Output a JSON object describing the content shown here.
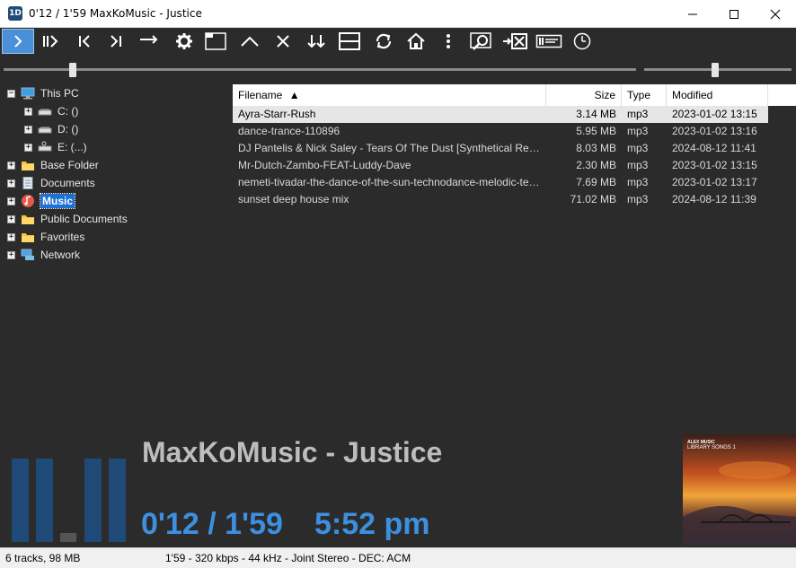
{
  "window": {
    "title": "0'12 / 1'59 MaxKoMusic - Justice",
    "app_icon_text": "1D"
  },
  "toolbar": {
    "buttons": [
      {
        "name": "play-icon"
      },
      {
        "name": "pause-play-icon"
      },
      {
        "name": "previous-track-icon"
      },
      {
        "name": "next-track-icon"
      },
      {
        "name": "arrow-right-icon"
      },
      {
        "name": "gear-icon"
      },
      {
        "name": "window-icon"
      },
      {
        "name": "chevron-up-icon"
      },
      {
        "name": "close-x-icon"
      },
      {
        "name": "sort-down-icon"
      },
      {
        "name": "split-view-icon"
      },
      {
        "name": "refresh-icon"
      },
      {
        "name": "home-icon"
      },
      {
        "name": "more-vertical-icon"
      },
      {
        "name": "search-icon"
      },
      {
        "name": "remove-icon"
      },
      {
        "name": "playlist-icon"
      },
      {
        "name": "clock-icon"
      }
    ]
  },
  "sliders": {
    "position_fraction": 0.11,
    "volume_fraction": 0.48
  },
  "tree": {
    "items": [
      {
        "label": "This PC",
        "icon": "monitor-icon",
        "expander": "−"
      },
      {
        "label": "C: ()",
        "icon": "drive-icon",
        "expander": "+"
      },
      {
        "label": "D: ()",
        "icon": "drive-icon",
        "expander": "+"
      },
      {
        "label": "E: (...)",
        "icon": "network-drive-icon",
        "expander": "+"
      },
      {
        "label": "Base Folder",
        "icon": "folder-icon",
        "expander": "+"
      },
      {
        "label": "Documents",
        "icon": "documents-icon",
        "expander": "+"
      },
      {
        "label": "Music",
        "icon": "music-icon",
        "expander": "+",
        "selected": true
      },
      {
        "label": "Public Documents",
        "icon": "folder-icon",
        "expander": "+"
      },
      {
        "label": "Favorites",
        "icon": "folder-icon",
        "expander": "+"
      },
      {
        "label": "Network",
        "icon": "network-icon",
        "expander": "+"
      }
    ]
  },
  "filelist": {
    "columns": {
      "filename": "Filename",
      "sort_arrow": "▲",
      "size": "Size",
      "type": "Type",
      "modified": "Modified"
    },
    "rows": [
      {
        "filename": "Ayra-Starr-Rush",
        "size": "3.14 MB",
        "type": "mp3",
        "modified": "2023-01-02 13:15",
        "selected": true
      },
      {
        "filename": "dance-trance-110896",
        "size": "5.95 MB",
        "type": "mp3",
        "modified": "2023-01-02 13:16"
      },
      {
        "filename": "DJ Pantelis & Nick Saley - Tears Of The Dust [Synthetical Records Release]",
        "size": "8.03 MB",
        "type": "mp3",
        "modified": "2024-08-12 11:41"
      },
      {
        "filename": "Mr-Dutch-Zambo-FEAT-Luddy-Dave",
        "size": "2.30 MB",
        "type": "mp3",
        "modified": "2023-01-02 13:15"
      },
      {
        "filename": "nemeti-tivadar-the-dance-of-the-sun-technodance-melodic-techno",
        "size": "7.69 MB",
        "type": "mp3",
        "modified": "2023-01-02 13:17"
      },
      {
        "filename": "sunset deep house mix",
        "size": "71.02 MB",
        "type": "mp3",
        "modified": "2024-08-12 11:39"
      }
    ]
  },
  "now_playing": {
    "title": "MaxKoMusic - Justice",
    "time": "0'12 / 1'59",
    "clock": "5:52 pm",
    "vu_levels": [
      0.97,
      0.97,
      0.1,
      0.97,
      0.97
    ],
    "cover_text_line1": "ALEX MUSIC",
    "cover_text_line2": "LIBRARY SONGS 1"
  },
  "status": {
    "left": "6 tracks, 98 MB",
    "middle": "1'59 - 320 kbps - 44 kHz - Joint Stereo - DEC: ACM"
  },
  "colors": {
    "accent": "#3d8fe0",
    "vu_bar": "#1f4a78",
    "selection": "#1e6fd6"
  }
}
